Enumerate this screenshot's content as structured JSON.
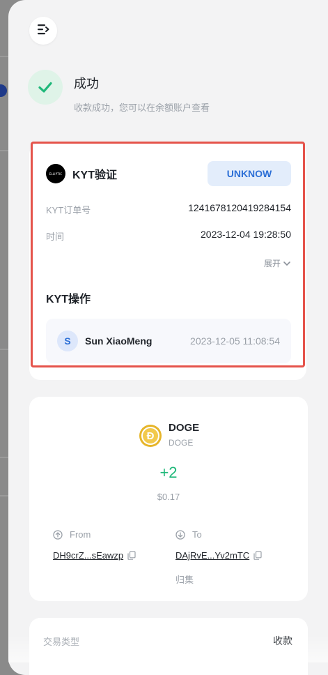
{
  "colors": {
    "success_green": "#1fb87a",
    "accent_blue": "#2c6fd6",
    "highlight_red": "#e5534b",
    "doge_gold": "#e6b52a"
  },
  "header": {
    "menu_icon": "menu-collapse-icon"
  },
  "status": {
    "title": "成功",
    "subtitle": "收款成功，您可以在余额账户查看",
    "icon": "check-icon"
  },
  "kyt": {
    "logo_text": "ELLIPTIC",
    "title": "KYT验证",
    "status_label": "UNKNOW",
    "order_label": "KYT订单号",
    "order_value": "1241678120419284154",
    "time_label": "时间",
    "time_value": "2023-12-04 19:28:50",
    "expand_label": "展开",
    "operations_title": "KYT操作",
    "operation": {
      "avatar_initial": "S",
      "name": "Sun XiaoMeng",
      "time": "2023-12-05 11:08:54"
    }
  },
  "transaction": {
    "coin_symbol": "DOGE",
    "coin_network": "DOGE",
    "amount": "+2",
    "amount_usd": "$0.17",
    "from_label": "From",
    "from_address": "DH9crZ...sEawzp",
    "to_label": "To",
    "to_address": "DAjRvE...Yv2mTC",
    "to_tag": "归集"
  },
  "details": {
    "type_label": "交易类型",
    "type_value": "收款"
  }
}
